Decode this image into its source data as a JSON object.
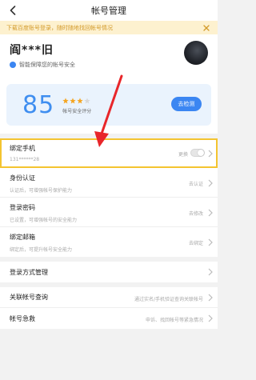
{
  "nav": {
    "title": "帐号管理"
  },
  "notice": {
    "text": "下载百度账号登录，随时随地找回帐号情况"
  },
  "profile": {
    "name": "阎***旧",
    "desc": "智能保障您的帐号安全"
  },
  "score": {
    "value": "85",
    "stars_filled": 3,
    "stars_total": 4,
    "label": "帐号安全评分",
    "recheck_label": "去检测"
  },
  "security_list": [
    {
      "title": "绑定手机",
      "sub": "131******28",
      "status": "更换"
    },
    {
      "title": "身份认证",
      "sub": "认证后，可增强帐号保护能力",
      "status": "去认证"
    },
    {
      "title": "登录密码",
      "sub": "已设置，可增强帐号的安全能力",
      "status": "去修改"
    },
    {
      "title": "绑定邮箱",
      "sub": "绑定后，可提升帐号安全能力",
      "status": "去绑定"
    }
  ],
  "login_list": [
    {
      "title": "登录方式管理",
      "status": ""
    }
  ],
  "assoc_list": [
    {
      "title": "关联帐号查询",
      "status": "通过实名/手机验证查询关联帐号"
    },
    {
      "title": "帐号急救",
      "status": "申诉、找回帐号等紧急情况"
    }
  ],
  "colors": {
    "accent": "#3b86f2",
    "score": "#3f8ef0",
    "highlight": "#f4c430",
    "notice_bg": "#fdf1cf",
    "annotation_arrow": "#e8262a"
  }
}
